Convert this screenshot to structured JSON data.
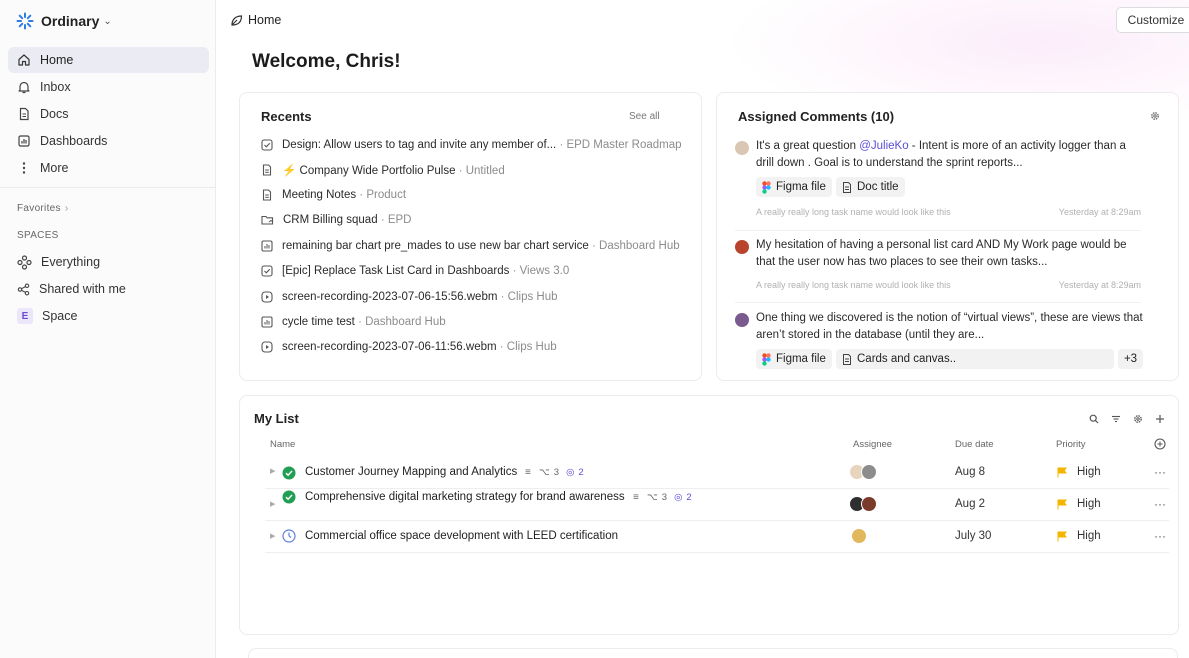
{
  "workspace": {
    "name": "Ordinary"
  },
  "sidebar": {
    "nav": [
      {
        "label": "Home",
        "icon": "home-icon"
      },
      {
        "label": "Inbox",
        "icon": "bell-icon"
      },
      {
        "label": "Docs",
        "icon": "doc-icon"
      },
      {
        "label": "Dashboards",
        "icon": "dashboard-icon"
      },
      {
        "label": "More",
        "icon": "more-vertical-icon"
      }
    ],
    "favorites_label": "Favorites",
    "spaces_label": "SPACES",
    "spaces": [
      {
        "label": "Everything",
        "icon": "everything-icon"
      },
      {
        "label": "Shared with me",
        "icon": "share-icon"
      },
      {
        "label": "Space",
        "badge": "E"
      }
    ]
  },
  "topbar": {
    "breadcrumb": "Home",
    "customize_label": "Customize"
  },
  "welcome": "Welcome, Chris!",
  "recents": {
    "title": "Recents",
    "see_all": "See all",
    "items": [
      {
        "name": "Design: Allow users to tag and invite any member of...",
        "location": "· EPD Master Roadmap",
        "icon": "task-check-icon"
      },
      {
        "name": "Company Wide Portfolio Pulse",
        "location": "· Untitled",
        "icon": "doc-icon",
        "prefix": "⚡"
      },
      {
        "name": "Meeting Notes",
        "location": "· Product",
        "icon": "doc-icon"
      },
      {
        "name": "CRM Billing squad",
        "location": "· EPD",
        "icon": "folder-icon"
      },
      {
        "name": "remaining bar chart pre_mades to use new bar chart service",
        "location": "· Dashboard Hub",
        "icon": "dashboard-icon"
      },
      {
        "name": "[Epic] Replace Task List Card in Dashboards",
        "location": "· Views 3.0",
        "icon": "task-check-icon"
      },
      {
        "name": "screen-recording-2023-07-06-15:56.webm",
        "location": "· Clips Hub",
        "icon": "play-icon"
      },
      {
        "name": "cycle time test",
        "location": "· Dashboard Hub",
        "icon": "dashboard-icon"
      },
      {
        "name": "screen-recording-2023-07-06-11:56.webm",
        "location": "· Clips Hub",
        "icon": "play-icon"
      }
    ]
  },
  "comments": {
    "title": "Assigned Comments (10)",
    "items": [
      {
        "text_before": "It's a great question ",
        "mention": "@JulieKo",
        "text_after": " - Intent is  more of an activity logger than a drill down . Goal is to understand the sprint reports...",
        "chips": [
          "Figma file",
          "Doc title"
        ],
        "task_name": "A really really long task name would look like this",
        "time": "Yesterday at 8:29am"
      },
      {
        "text": "My hesitation of having a personal list card AND My Work page would be that the user now has two places to see their own tasks...",
        "task_name": "A really really long task name would look like this",
        "time": "Yesterday at 8:29am"
      },
      {
        "text": "One thing we discovered is the notion of “virtual views”, these are views that aren’t stored in the database (until they are...",
        "chips": [
          "Figma file",
          "Cards and canvas.."
        ],
        "more": "+3"
      }
    ]
  },
  "my_list": {
    "title": "My List",
    "columns": {
      "name": "Name",
      "assignee": "Assignee",
      "due": "Due date",
      "priority": "Priority"
    },
    "tasks": [
      {
        "name": "Customer Journey Mapping and Analytics",
        "subtasks": "3",
        "checklist": "2",
        "due": "Aug 8",
        "priority": "High",
        "status": "complete"
      },
      {
        "name": "Comprehensive digital marketing strategy for brand awareness",
        "subtasks": "3",
        "checklist": "2",
        "due": "Aug 2",
        "priority": "High",
        "status": "complete"
      },
      {
        "name": "Commercial office space development with LEED certification",
        "due": "July 30",
        "priority": "High",
        "status": "in-progress"
      }
    ],
    "more_label": "···"
  },
  "colors": {
    "accent": "#5b4fd6",
    "complete": "#1f9e54",
    "priority_high": "#f5b400",
    "active_nav": "#ebebf3"
  }
}
